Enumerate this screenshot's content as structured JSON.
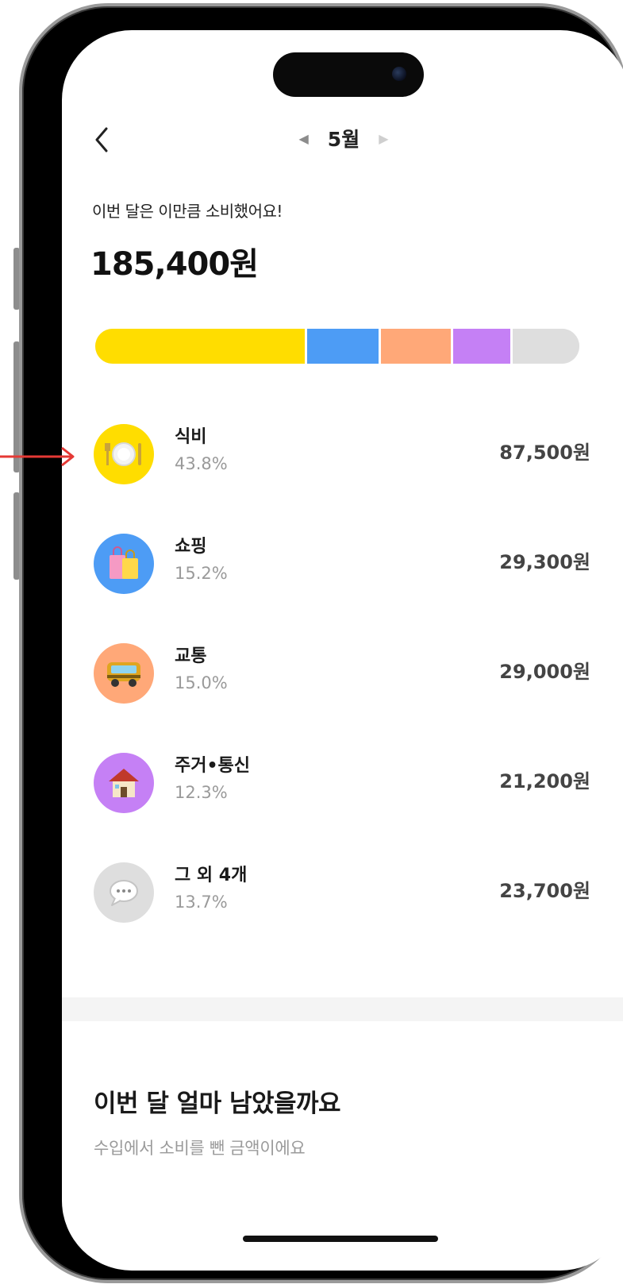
{
  "header": {
    "back_icon": "chevron-left-icon",
    "month_label": "5월",
    "prev_icon": "triangle-left-icon",
    "next_icon": "triangle-right-icon"
  },
  "summary": {
    "subtitle": "이번 달은 이만큼 소비했어요!",
    "total": "185,400원"
  },
  "spending_bar": {
    "segments": [
      {
        "category": "식비",
        "share": 43.8,
        "color": "#FFDD00"
      },
      {
        "category": "쇼핑",
        "share": 15.2,
        "color": "#4D9CF5"
      },
      {
        "category": "교통",
        "share": 15.0,
        "color": "#FFA878"
      },
      {
        "category": "주거·통신",
        "share": 12.3,
        "color": "#C580F5"
      },
      {
        "category": "그 외 4개",
        "share": 13.7,
        "color": "#DEDEDE"
      }
    ]
  },
  "categories": [
    {
      "name": "식비",
      "percent": "43.8%",
      "amount": "87,500원",
      "icon": "plate-cutlery-icon",
      "color": "#FFDD00"
    },
    {
      "name": "쇼핑",
      "percent": "15.2%",
      "amount": "29,300원",
      "icon": "shopping-bag-icon",
      "color": "#4D9CF5"
    },
    {
      "name": "교통",
      "percent": "15.0%",
      "amount": "29,000원",
      "icon": "bus-icon",
      "color": "#FFA878"
    },
    {
      "name": "주거•통신",
      "percent": "12.3%",
      "amount": "21,200원",
      "icon": "house-icon",
      "color": "#C580F5"
    },
    {
      "name": "그 외 4개",
      "percent": "13.7%",
      "amount": "23,700원",
      "icon": "speech-bubble-icon",
      "color": "#DEDEDE"
    }
  ],
  "remaining": {
    "title": "이번 달 얼마 남았을까요",
    "subtitle": "수입에서 소비를 뺀 금액이에요"
  },
  "annotation": {
    "pointer_icon": "red-arrow-icon",
    "pointer_color": "#E53935"
  }
}
